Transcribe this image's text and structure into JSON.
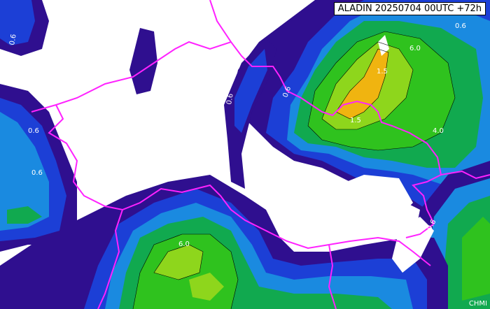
{
  "header": {
    "model": "ALADIN",
    "run": "20250704 00UTC",
    "lead": "+72h"
  },
  "contour_labels": [
    "0.6",
    "0.6",
    "0.6",
    "0.6",
    "0.6",
    "0.6",
    "1.5",
    "1.5",
    "6.0",
    "6.0",
    "4.0",
    "0.6",
    "0.6"
  ],
  "colors": {
    "level_0": "#2f0f8f",
    "level_1": "#1c3fd6",
    "level_2": "#1a8ae0",
    "level_3": "#11a94f",
    "level_4": "#2fc21e",
    "level_5": "#8ed61c",
    "level_6": "#f0b410",
    "border": "#ff22ff"
  },
  "watermark": "CHMI"
}
